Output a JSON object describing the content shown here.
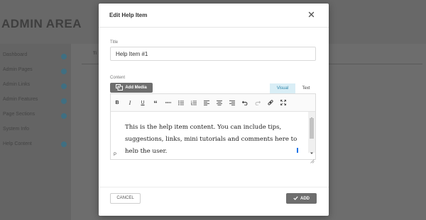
{
  "background": {
    "app_title": "ADMIN AREA",
    "sidebar_items": [
      "Dashboard",
      "Admin Pages",
      "Admin Links",
      "Admin Features",
      "Page Sections",
      "System Info",
      "Help Content"
    ],
    "column_header": "Ti"
  },
  "modal": {
    "title": "Edit Help Item",
    "title_field": {
      "label": "Title",
      "value": "Help Item #1"
    },
    "content_label": "Content",
    "add_media_label": "Add Media",
    "tabs": {
      "visual": "Visual",
      "text": "Text"
    },
    "toolbar_icons": [
      "bold-icon",
      "italic-icon",
      "underline-icon",
      "blockquote-icon",
      "horizontal-line-icon",
      "bullet-list-icon",
      "numbered-list-icon",
      "align-left-icon",
      "align-center-icon",
      "align-right-icon",
      "undo-icon",
      "redo-icon",
      "link-icon",
      "fullscreen-icon"
    ],
    "toolbar_labels": {
      "bold": "B",
      "italic": "I",
      "underline": "U",
      "quote": "“"
    },
    "content_text": "This is the help item content. You can include tips, suggestions, links, mini tutorials and comments here to help the user.",
    "status_path": "P",
    "cancel_label": "CANCEL",
    "add_label": "ADD"
  },
  "colors": {
    "accent": "#1e88e5",
    "visual_tab_bg": "#d9eef6",
    "button_gray": "#6e6e6e"
  }
}
